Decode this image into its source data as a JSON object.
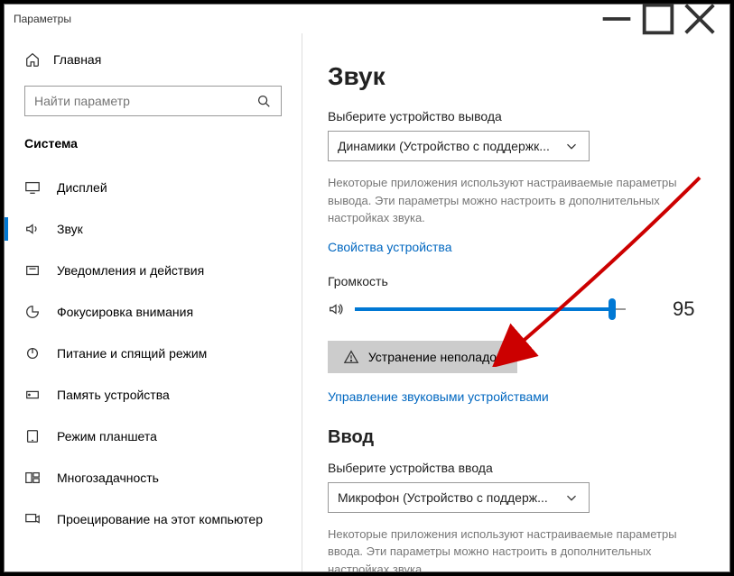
{
  "window": {
    "title": "Параметры"
  },
  "sidebar": {
    "home": "Главная",
    "search_placeholder": "Найти параметр",
    "category": "Система",
    "items": [
      {
        "label": "Дисплей"
      },
      {
        "label": "Звук"
      },
      {
        "label": "Уведомления и действия"
      },
      {
        "label": "Фокусировка внимания"
      },
      {
        "label": "Питание и спящий режим"
      },
      {
        "label": "Память устройства"
      },
      {
        "label": "Режим планшета"
      },
      {
        "label": "Многозадачность"
      },
      {
        "label": "Проецирование на этот компьютер"
      }
    ]
  },
  "main": {
    "heading": "Звук",
    "output": {
      "label": "Выберите устройство вывода",
      "value": "Динамики (Устройство с поддержк...",
      "desc": "Некоторые приложения используют настраиваемые параметры вывода. Эти параметры можно настроить в дополнительных настройках звука.",
      "props_link": "Свойства устройства"
    },
    "volume": {
      "label": "Громкость",
      "value": 95
    },
    "troubleshoot": "Устранение неполадок",
    "manage_link": "Управление звуковыми устройствами",
    "input_heading": "Ввод",
    "input": {
      "label": "Выберите устройства ввода",
      "value": "Микрофон (Устройство с поддерж...",
      "desc": "Некоторые приложения используют настраиваемые параметры ввода. Эти параметры можно настроить в дополнительных настройках звука."
    }
  }
}
